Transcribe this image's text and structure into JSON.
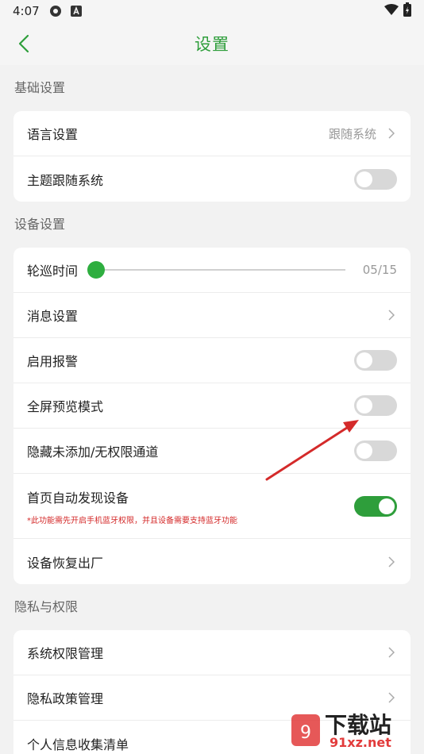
{
  "status": {
    "time": "4:07"
  },
  "header": {
    "title": "设置"
  },
  "sections": {
    "basic": {
      "title": "基础设置",
      "language": {
        "label": "语言设置",
        "value": "跟随系统"
      },
      "theme": {
        "label": "主题跟随系统",
        "on": false
      }
    },
    "device": {
      "title": "设备设置",
      "patrol": {
        "label": "轮巡时间",
        "value": "05/15"
      },
      "message": {
        "label": "消息设置"
      },
      "alarm": {
        "label": "启用报警",
        "on": false
      },
      "fullscreen": {
        "label": "全屏预览模式",
        "on": false
      },
      "hide": {
        "label": "隐藏未添加/无权限通道",
        "on": false
      },
      "autodiscover": {
        "label": "首页自动发现设备",
        "note": "*此功能需先开启手机蓝牙权限，并且设备需要支持蓝牙功能",
        "on": true
      },
      "reset": {
        "label": "设备恢复出厂"
      }
    },
    "privacy": {
      "title": "隐私与权限",
      "permissions": {
        "label": "系统权限管理"
      },
      "policy": {
        "label": "隐私政策管理"
      },
      "info": {
        "label": "个人信息收集清单"
      }
    }
  },
  "watermark": {
    "text": "下载站",
    "site": "91xz.net"
  },
  "colors": {
    "accent": "#2e9e3b",
    "note": "#d42a2a",
    "annotation_arrow": "#d42a2a"
  }
}
